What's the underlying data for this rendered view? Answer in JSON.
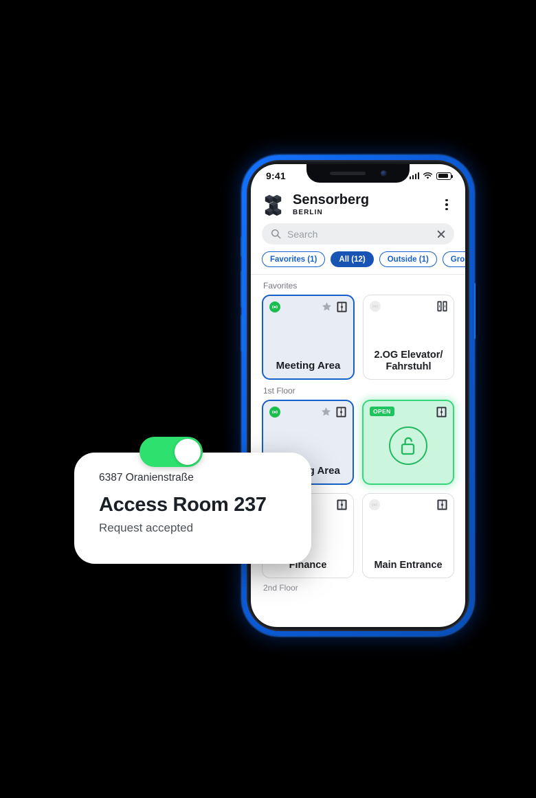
{
  "statusbar": {
    "time": "9:41",
    "signal_icon": "cellular-signal-icon",
    "wifi_icon": "wifi-icon",
    "battery_icon": "battery-icon"
  },
  "header": {
    "logo_icon": "sensorberg-cubes-logo",
    "brand_name": "Sensorberg",
    "brand_subtitle": "BERLIN",
    "menu_icon": "kebab-menu-icon"
  },
  "search": {
    "placeholder": "Search",
    "value": "",
    "search_icon": "search-icon",
    "clear_icon": "close-icon"
  },
  "filters": [
    {
      "label": "Favorites (1)",
      "active": false
    },
    {
      "label": "All (12)",
      "active": true
    },
    {
      "label": "Outside (1)",
      "active": false
    },
    {
      "label": "Ground",
      "active": false
    }
  ],
  "sections": [
    {
      "label": "Favorites",
      "cards": [
        {
          "label": "Meeting Area",
          "state": "selected",
          "badge": "bluetooth-connected",
          "favorite": true,
          "type_icon": "door-icon"
        },
        {
          "label": "2.OG Elevator/ Fahrstuhl",
          "state": "default",
          "badge": "bluetooth-off",
          "favorite": false,
          "type_icon": "elevator-icon"
        }
      ]
    },
    {
      "label": "1st Floor",
      "cards": [
        {
          "label": "Meeting Area",
          "state": "selected",
          "badge": "bluetooth-connected",
          "favorite": true,
          "type_icon": "door-icon"
        },
        {
          "label": "",
          "state": "open",
          "badge_text": "OPEN",
          "favorite": false,
          "type_icon": "door-icon",
          "center_icon": "unlocked-padlock-icon"
        },
        {
          "label": "Finance",
          "state": "default",
          "badge": "none",
          "favorite": false,
          "type_icon": "door-icon"
        },
        {
          "label": "Main Entrance",
          "state": "default",
          "badge": "bluetooth-off",
          "favorite": false,
          "type_icon": "door-icon"
        }
      ]
    },
    {
      "label": "2nd Floor",
      "cards": []
    }
  ],
  "toast": {
    "eyebrow": "6387 Oranienstraße",
    "title": "Access Room 237",
    "subtitle": "Request accepted",
    "toggle_state": "on",
    "toggle_icon": "toggle-switch-on"
  },
  "colors": {
    "brand_blue": "#1854b4",
    "chip_blue": "#1560c8",
    "open_green": "#34d77a",
    "open_fill": "#ccf5dd",
    "toggle_green": "#2ee06e",
    "badge_green": "#1bbd4e",
    "selected_fill": "#e8ecf5",
    "frame_blue": "#1472ff",
    "page_background": "#000000"
  }
}
